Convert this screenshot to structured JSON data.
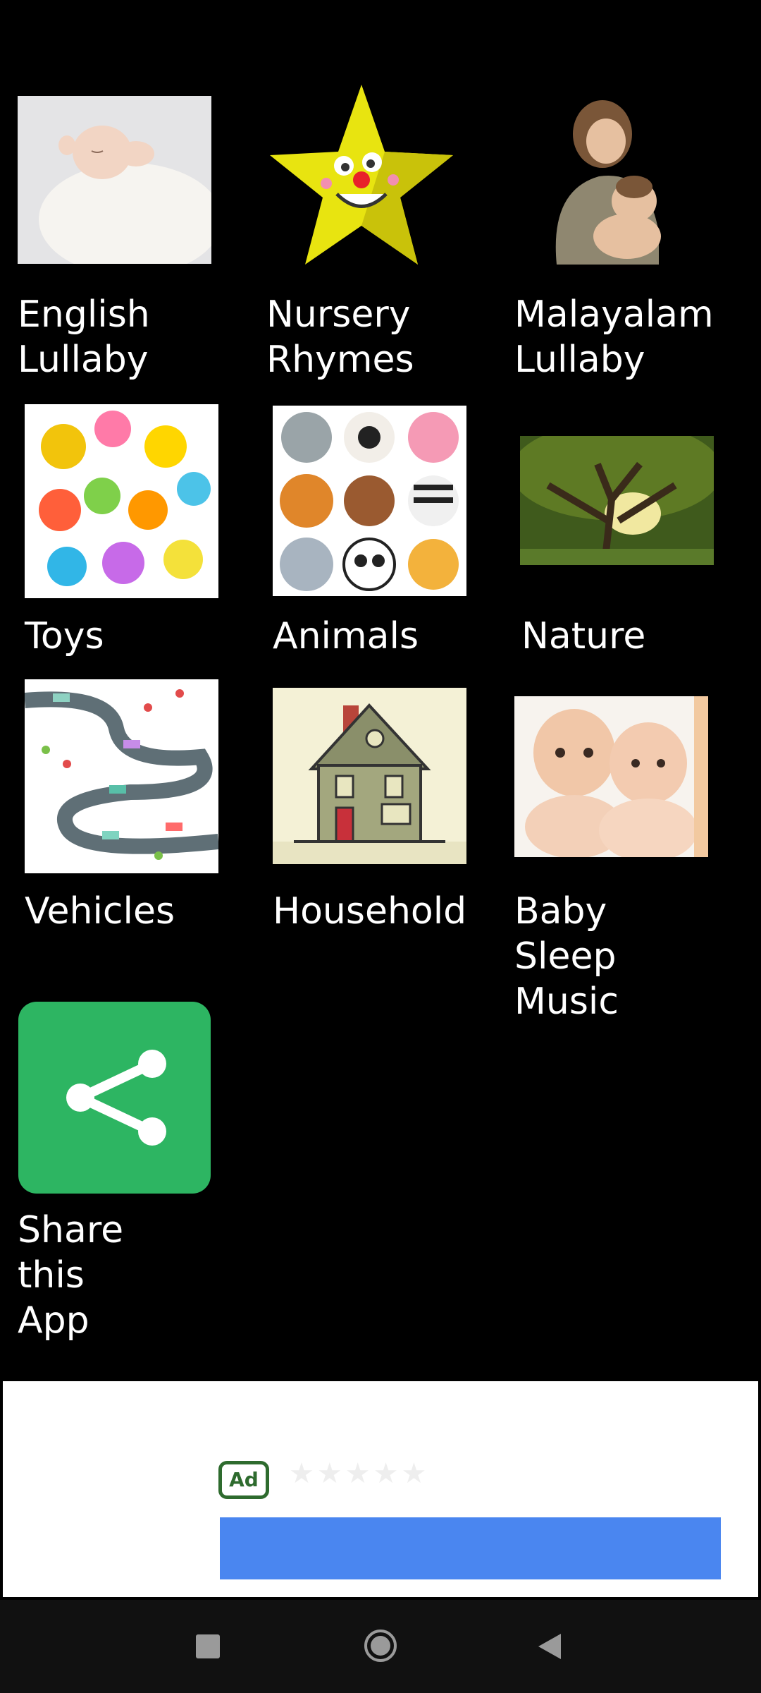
{
  "tiles": [
    {
      "label": "English\nLullaby"
    },
    {
      "label": "Nursery\nRhymes"
    },
    {
      "label": "Malayalam\nLullaby"
    },
    {
      "label": "Toys"
    },
    {
      "label": "Animals"
    },
    {
      "label": "Nature"
    },
    {
      "label": "Vehicles"
    },
    {
      "label": "Household"
    },
    {
      "label": "Baby Sleep\nMusic"
    },
    {
      "label": "Share this\nApp"
    }
  ],
  "ad": {
    "badge": "Ad",
    "stars": "★★★★★"
  },
  "colors": {
    "share_tile": "#2db562",
    "ad_button": "#4a86f0",
    "ad_badge": "#2e6b2e"
  },
  "nav": {
    "items": [
      "recent-apps-icon",
      "home-icon",
      "back-icon"
    ]
  }
}
